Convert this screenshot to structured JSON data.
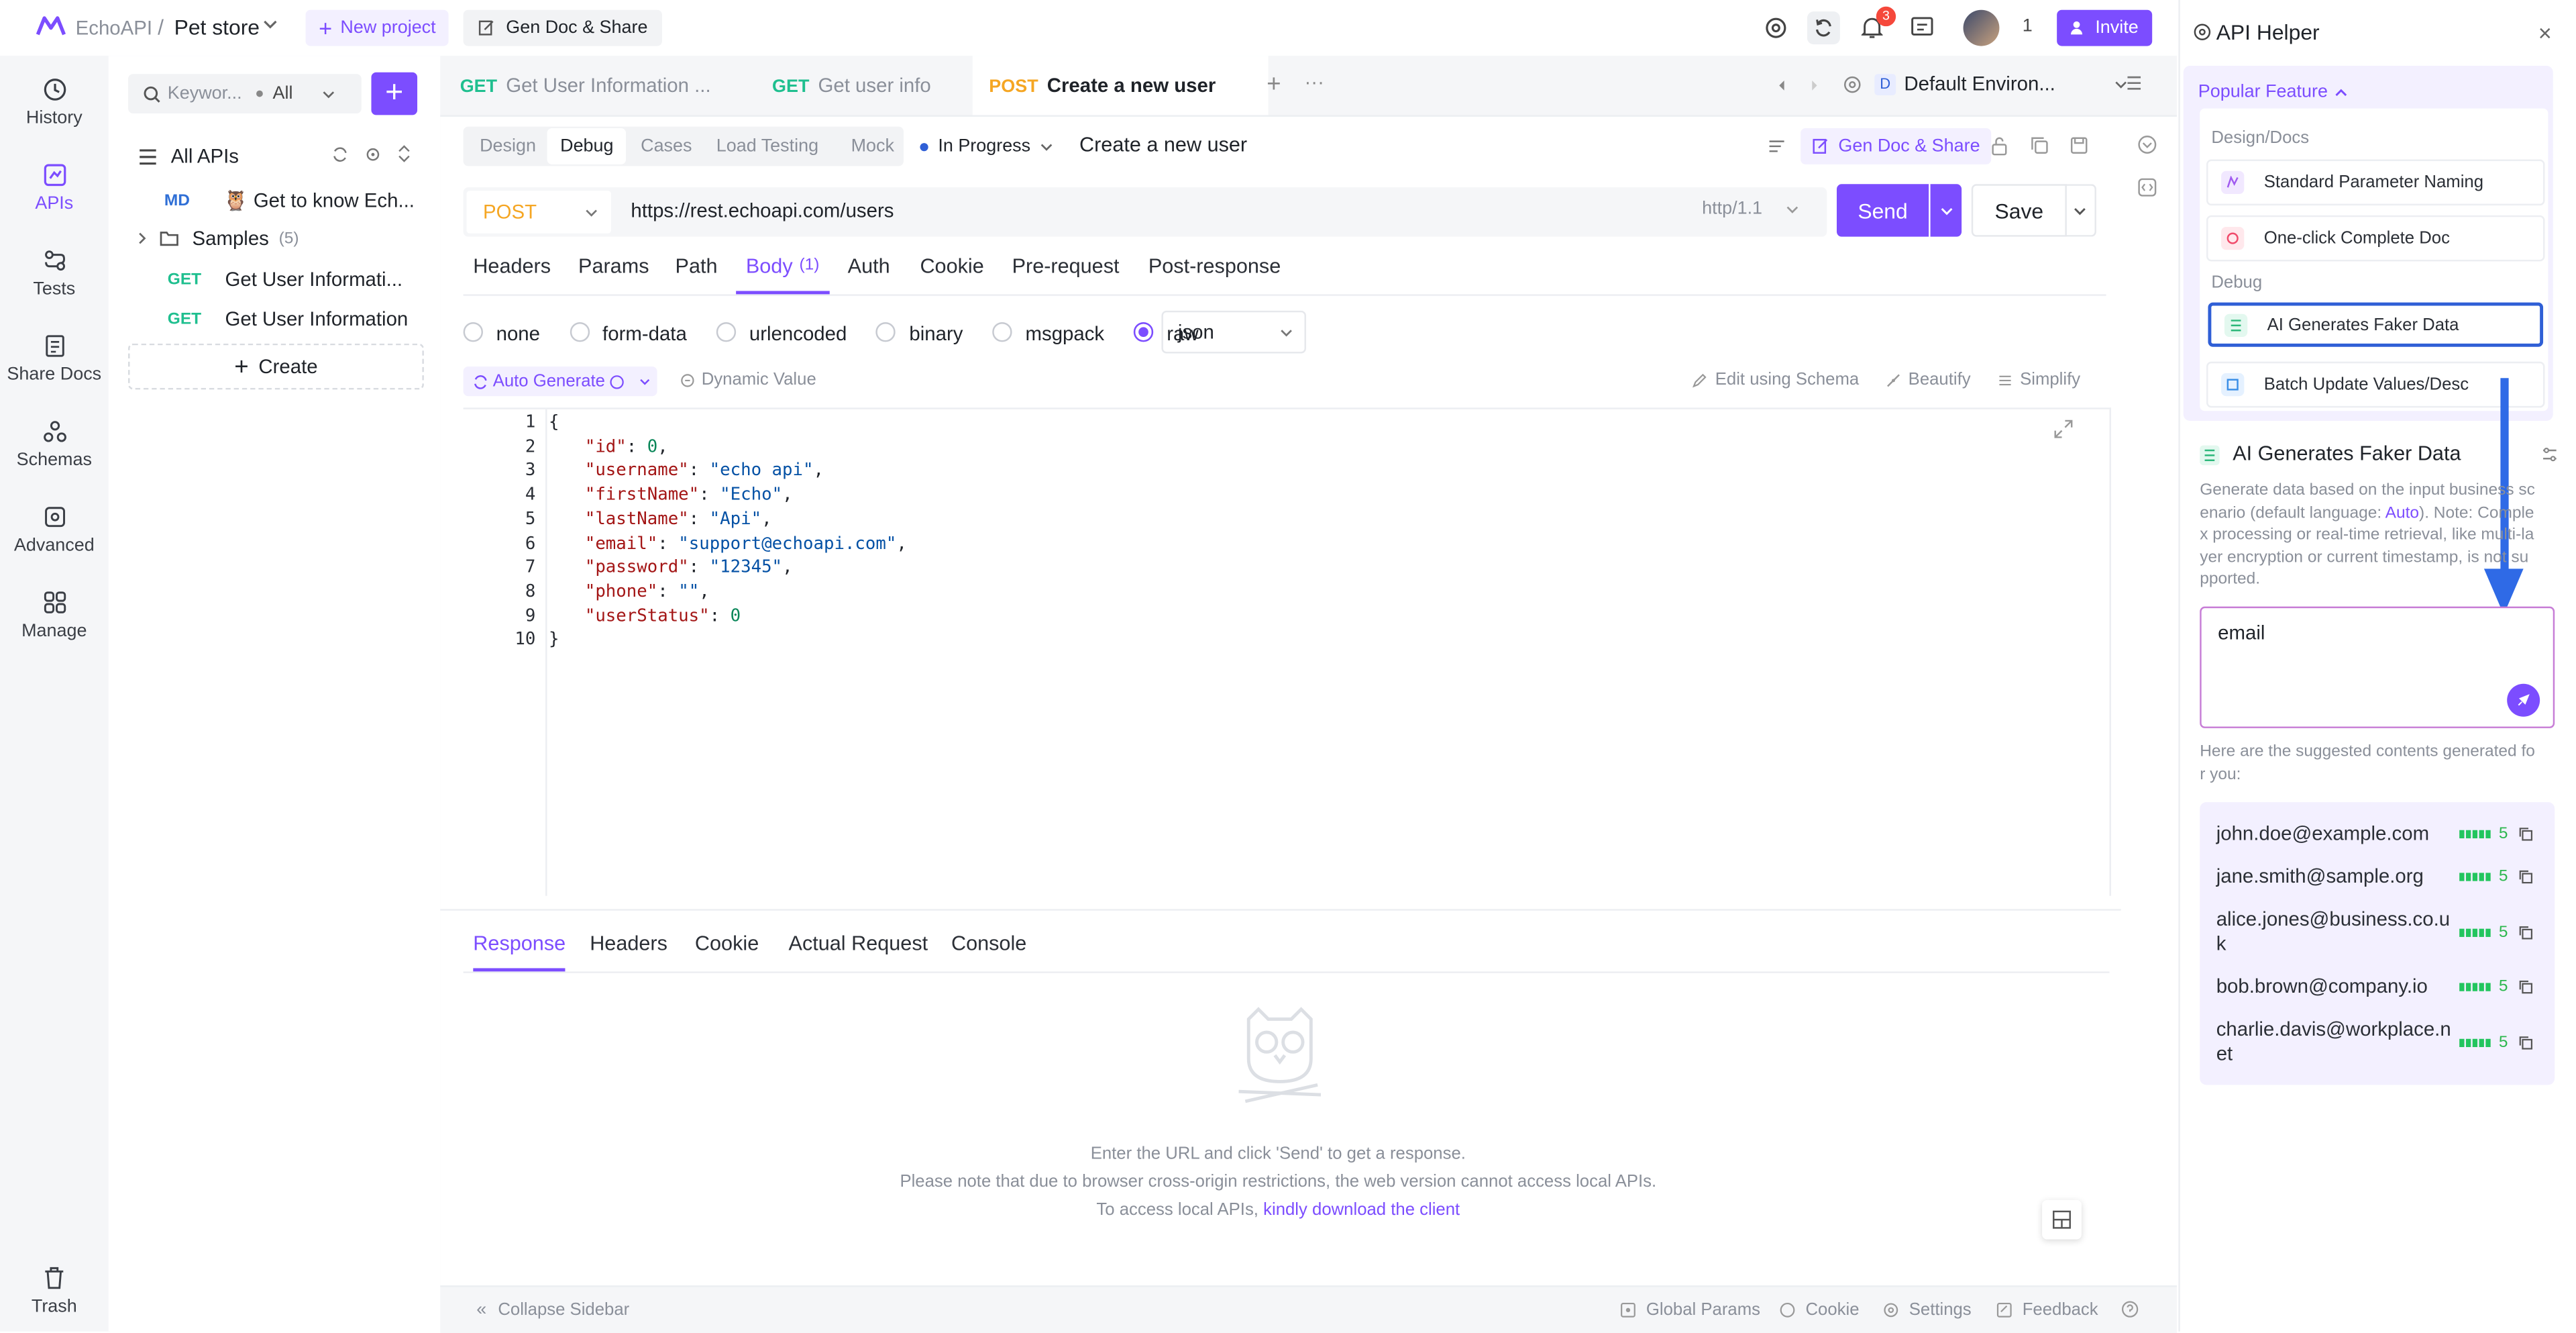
{
  "topbar": {
    "brand": "EchoAPI",
    "separator": "/",
    "project": "Pet store",
    "new_project": "New project",
    "gen_doc": "Gen Doc & Share",
    "notif_count": "3",
    "team_count": "1",
    "invite": "Invite"
  },
  "nav": [
    {
      "label": "History",
      "icon": "clock-icon"
    },
    {
      "label": "APIs",
      "icon": "api-icon"
    },
    {
      "label": "Tests",
      "icon": "tests-icon"
    },
    {
      "label": "Share Docs",
      "icon": "docs-icon"
    },
    {
      "label": "Schemas",
      "icon": "schema-icon"
    },
    {
      "label": "Advanced",
      "icon": "advanced-icon"
    },
    {
      "label": "Manage",
      "icon": "manage-icon"
    },
    {
      "label": "Trash",
      "icon": "trash-icon"
    }
  ],
  "tree": {
    "search_placeholder": "Keywor...",
    "filter": "All",
    "all_apis": "All APIs",
    "items": [
      {
        "method": "MD",
        "label": "🦉 Get to know Ech..."
      },
      {
        "method": "",
        "label": "Samples",
        "count": "(5)"
      },
      {
        "method": "GET",
        "label": "Get User Informati..."
      },
      {
        "method": "GET",
        "label": "Get User Information"
      }
    ],
    "create": "Create"
  },
  "tabs": [
    {
      "method": "GET",
      "label": "Get User Information ..."
    },
    {
      "method": "GET",
      "label": "Get user info"
    },
    {
      "method": "POST",
      "label": "Create a new user"
    }
  ],
  "environment": {
    "badge": "D",
    "label": "Default Environ..."
  },
  "subtabs": [
    "Design",
    "Debug",
    "Cases",
    "Load Testing",
    "Mock"
  ],
  "status": "In Progress",
  "request_name": "Create a new user",
  "gen_doc_share": "Gen Doc & Share",
  "request": {
    "method": "POST",
    "url": "https://rest.echoapi.com/users",
    "protocol": "http/1.1",
    "send": "Send",
    "save": "Save"
  },
  "request_tabs": [
    "Headers",
    "Params",
    "Path",
    "Body",
    "Auth",
    "Cookie",
    "Pre-request",
    "Post-response"
  ],
  "body_count": "(1)",
  "body_types": [
    "none",
    "form-data",
    "urlencoded",
    "binary",
    "msgpack",
    "raw"
  ],
  "body_format": "json",
  "tools": {
    "auto_generate": "Auto Generate",
    "dynamic_value": "Dynamic Value",
    "edit_schema": "Edit using Schema",
    "beautify": "Beautify",
    "simplify": "Simplify"
  },
  "code": [
    {
      "n": "1",
      "text": "{"
    },
    {
      "n": "2",
      "key": "\"id\"",
      "val": "0",
      "vtype": "num",
      "comma": ","
    },
    {
      "n": "3",
      "key": "\"username\"",
      "val": "\"echo api\"",
      "vtype": "str",
      "comma": ","
    },
    {
      "n": "4",
      "key": "\"firstName\"",
      "val": "\"Echo\"",
      "vtype": "str",
      "comma": ","
    },
    {
      "n": "5",
      "key": "\"lastName\"",
      "val": "\"Api\"",
      "vtype": "str",
      "comma": ","
    },
    {
      "n": "6",
      "key": "\"email\"",
      "val": "\"support@echoapi.com\"",
      "vtype": "str",
      "comma": ","
    },
    {
      "n": "7",
      "key": "\"password\"",
      "val": "\"12345\"",
      "vtype": "str",
      "comma": ","
    },
    {
      "n": "8",
      "key": "\"phone\"",
      "val": "\"\"",
      "vtype": "str",
      "comma": ","
    },
    {
      "n": "9",
      "key": "\"userStatus\"",
      "val": "0",
      "vtype": "num",
      "comma": ""
    },
    {
      "n": "10",
      "text": "}"
    }
  ],
  "response_tabs": [
    "Response",
    "Headers",
    "Cookie",
    "Actual Request",
    "Console"
  ],
  "response_empty": {
    "line1": "Enter the URL and click 'Send' to get a response.",
    "line2": "Please note that due to browser cross-origin restrictions, the web version cannot access local APIs.",
    "line3_prefix": "To access local APIs,",
    "line3_link": "kindly download the client"
  },
  "footer": {
    "collapse": "Collapse Sidebar",
    "global_params": "Global Params",
    "cookie": "Cookie",
    "settings": "Settings",
    "feedback": "Feedback"
  },
  "helper": {
    "title": "API Helper",
    "popular": "Popular Feature",
    "group_design": "Design/Docs",
    "f1": "Standard Parameter Naming",
    "f2": "One-click Complete Doc",
    "group_debug": "Debug",
    "f3": "AI Generates Faker Data",
    "f4": "Batch Update Values/Desc",
    "section_title": "AI Generates Faker Data",
    "desc_a": "Generate data based on the input business sc",
    "desc_b": "enario (default language: ",
    "desc_lang": "Auto",
    "desc_c": "). Note: Comple",
    "desc_d": "x processing or real-time retrieval, like multi-la",
    "desc_e": "yer encryption or current timestamp, is not su",
    "desc_f": "pported.",
    "input_value": "email",
    "suggest_a": "Here are the suggested contents generated fo",
    "suggest_b": "r you:",
    "suggestions": [
      {
        "line1": "john.doe@example.com",
        "line2": "",
        "score": "5"
      },
      {
        "line1": "jane.smith@sample.org",
        "line2": "",
        "score": "5"
      },
      {
        "line1": "alice.jones@business.co.u",
        "line2": "k",
        "score": "5"
      },
      {
        "line1": "bob.brown@company.io",
        "line2": "",
        "score": "5"
      },
      {
        "line1": "charlie.davis@workplace.n",
        "line2": "et",
        "score": "5"
      }
    ]
  },
  "colors": {
    "accent": "#7c4dff",
    "highlight": "#2f5fd6",
    "get": "#1fbf8f",
    "post": "#f5a623"
  }
}
